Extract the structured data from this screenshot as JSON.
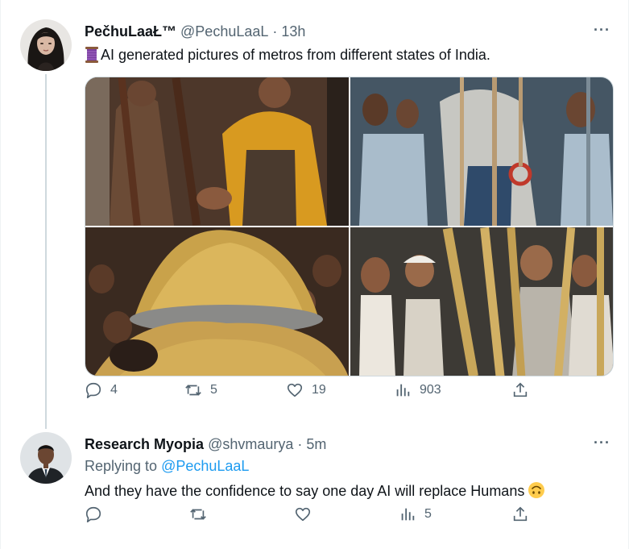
{
  "tweet1": {
    "name": "PečhuLaaŁ™",
    "handle": "@PechuLaaL",
    "separator": "·",
    "time": "13h",
    "more": "···",
    "text": "AI generated pictures of metros from different states of India.",
    "text_emoji_icon": "thread-spool-icon",
    "actions": {
      "replies": "4",
      "retweets": "5",
      "likes": "19",
      "views": "903"
    }
  },
  "tweet2": {
    "name": "Research Myopia",
    "handle": "@shvmaurya",
    "separator": "·",
    "time": "5m",
    "more": "···",
    "replying_prefix": "Replying to",
    "replying_to": "@PechuLaaL",
    "text": "And they have the confidence to say one day AI will replace Humans",
    "text_emoji_icon": "upside-down-face-icon",
    "actions": {
      "replies": "",
      "retweets": "",
      "likes": "",
      "views": "5"
    }
  },
  "colors": {
    "link": "#1d9bf0",
    "muted": "#536471",
    "text": "#0f1419",
    "thread_line": "#cfd9de"
  }
}
